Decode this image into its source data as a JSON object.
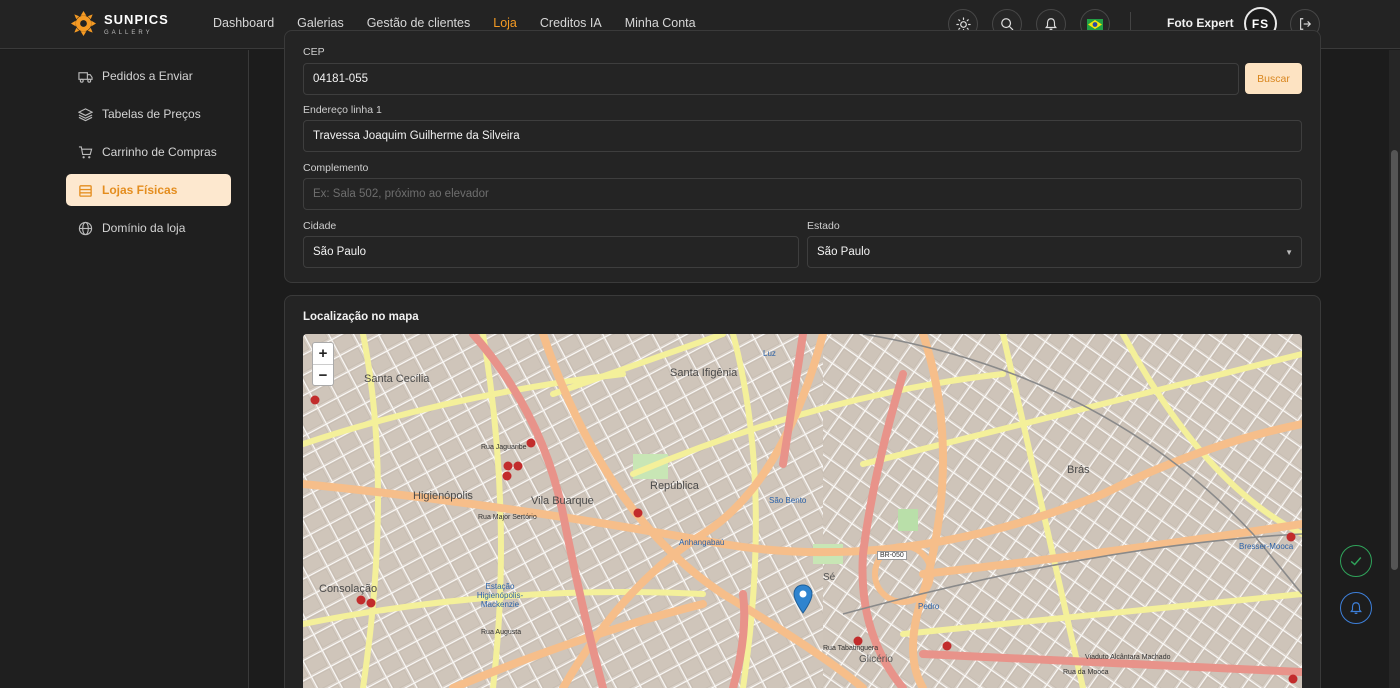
{
  "brand": {
    "name": "SUNPICS",
    "sub": "GALLERY",
    "color": "#f59a23"
  },
  "nav": {
    "items": [
      {
        "label": "Dashboard",
        "active": false
      },
      {
        "label": "Galerias",
        "active": false
      },
      {
        "label": "Gestão de clientes",
        "active": false
      },
      {
        "label": "Loja",
        "active": true
      },
      {
        "label": "Creditos IA",
        "active": false
      },
      {
        "label": "Minha Conta",
        "active": false
      }
    ],
    "icons": [
      "sun-icon",
      "search-icon",
      "bell-icon",
      "brazil-flag-icon"
    ],
    "user_name": "Foto Expert",
    "avatar_initials": "FS"
  },
  "sidebar": {
    "items": [
      {
        "label": "Pedidos a Enviar",
        "icon": "truck-icon",
        "active": false
      },
      {
        "label": "Tabelas de Preços",
        "icon": "layers-icon",
        "active": false
      },
      {
        "label": "Carrinho de Compras",
        "icon": "cart-icon",
        "active": false
      },
      {
        "label": "Lojas Físicas",
        "icon": "store-icon",
        "active": true
      },
      {
        "label": "Domínio da loja",
        "icon": "globe-icon",
        "active": false
      }
    ]
  },
  "form": {
    "cep_label": "CEP",
    "cep_value": "04181-055",
    "buscar_label": "Buscar",
    "address1_label": "Endereço linha 1",
    "address1_value": "Travessa Joaquim Guilherme da Silveira",
    "complement_label": "Complemento",
    "complement_placeholder": "Ex: Sala 502, próximo ao elevador",
    "city_label": "Cidade",
    "city_value": "São Paulo",
    "state_label": "Estado",
    "state_value": "São Paulo"
  },
  "map_card": {
    "title": "Localização no mapa",
    "zoom_in": "+",
    "zoom_out": "−",
    "labels": {
      "santa_cecilia": "Santa Cecília",
      "santa_ifigenia": "Santa Ifigênia",
      "luz": "Luz",
      "republica": "República",
      "vila_buarque": "Vila Buarque",
      "higienopolis": "Higienópolis",
      "consolacao": "Consolação",
      "bras": "Brás",
      "se": "Sé",
      "sao_bento": "São Bento",
      "anhangabau": "Anhangabaú",
      "bresser": "Bresser-Mooca",
      "pedro": "Pedro",
      "glicerio": "Glicério",
      "br050": "BR-050",
      "estacao": "Estação Higienópolis-Mackenzie",
      "rua_jaguaribe": "Rua Jaguaribe",
      "rua_augusta": "Rua Augusta",
      "rua_mooca": "Rua da Mooca",
      "viaduto": "Viaduto Alcântara Machado",
      "rua_tabatinguera": "Rua Tabatinguera",
      "rua_major_sertorio": "Rua Major Sertório"
    }
  },
  "floating": {
    "check_color": "#2fa35a",
    "bell_color": "#3d7fd9"
  }
}
